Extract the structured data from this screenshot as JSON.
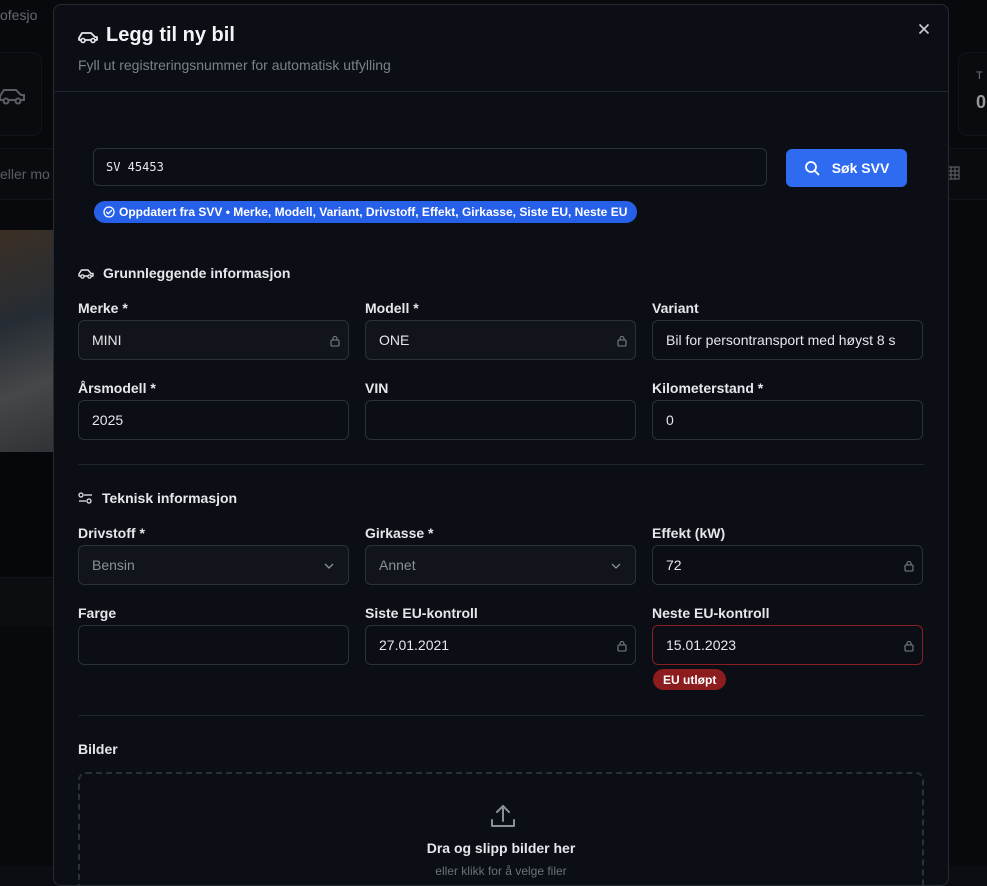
{
  "background": {
    "topbar_text": "ofesjo",
    "search_text": "eller mo",
    "right_card_label": "T",
    "right_card_value": "0"
  },
  "modal": {
    "title": "Legg til ny bil",
    "subtitle": "Fyll ut registreringsnummer for automatisk utfylling",
    "reg_input_value": "SV 45453",
    "search_button_label": "Søk SVV",
    "svv_status": "Oppdatert fra SVV • Merke, Modell, Variant, Drivstoff, Effekt, Girkasse, Siste EU, Neste EU",
    "basic_section_title": "Grunnleggende informasjon",
    "tech_section_title": "Teknisk informasjon",
    "images_section_title": "Bilder",
    "fields": {
      "merke": {
        "label": "Merke *",
        "value": "MINI",
        "locked": true
      },
      "modell": {
        "label": "Modell *",
        "value": "ONE",
        "locked": true
      },
      "variant": {
        "label": "Variant",
        "value": "Bil for persontransport med høyst 8 s"
      },
      "arsmodell": {
        "label": "Årsmodell *",
        "value": "2025"
      },
      "vin": {
        "label": "VIN",
        "value": ""
      },
      "kilometerstand": {
        "label": "Kilometerstand *",
        "value": "0"
      },
      "drivstoff": {
        "label": "Drivstoff *",
        "value": "Bensin"
      },
      "girkasse": {
        "label": "Girkasse *",
        "value": "Annet"
      },
      "effekt": {
        "label": "Effekt (kW)",
        "value": "72",
        "locked": true
      },
      "farge": {
        "label": "Farge",
        "value": ""
      },
      "siste_eu": {
        "label": "Siste EU-kontroll",
        "value": "27.01.2021",
        "locked": true
      },
      "neste_eu": {
        "label": "Neste EU-kontroll",
        "value": "15.01.2023",
        "locked": true
      }
    },
    "eu_badge": "EU utløpt",
    "dropzone": {
      "title": "Dra og slipp bilder her",
      "subtitle": "eller klikk for å velge filer"
    }
  },
  "colors": {
    "accent": "#2f6bf0",
    "error": "#8d1c1e",
    "background": "#0b0e15"
  },
  "icons": [
    "car-icon",
    "close-icon",
    "search-icon",
    "check-circle-icon",
    "sliders-icon",
    "lock-icon",
    "chevron-down-icon",
    "upload-icon"
  ]
}
